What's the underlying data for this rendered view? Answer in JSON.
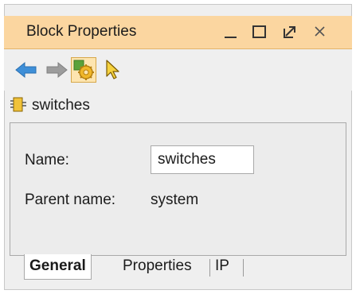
{
  "window": {
    "title": "Block Properties",
    "accent": "#fbd6a0",
    "controls": [
      "minimize-icon",
      "maximize-icon",
      "restore-icon",
      "close-icon"
    ]
  },
  "toolbar": {
    "buttons": [
      "back-arrow-icon",
      "forward-arrow-icon",
      "settings-gear-icon",
      "select-pointer-icon"
    ]
  },
  "block": {
    "icon": "block-icon",
    "name": "switches"
  },
  "general": {
    "name_label": "Name:",
    "name_value": "switches",
    "parent_label": "Parent name:",
    "parent_value": "system"
  },
  "tabs": [
    {
      "label": "General",
      "selected": true
    },
    {
      "label": "Properties",
      "selected": false
    },
    {
      "label": "IP",
      "selected": false
    }
  ]
}
